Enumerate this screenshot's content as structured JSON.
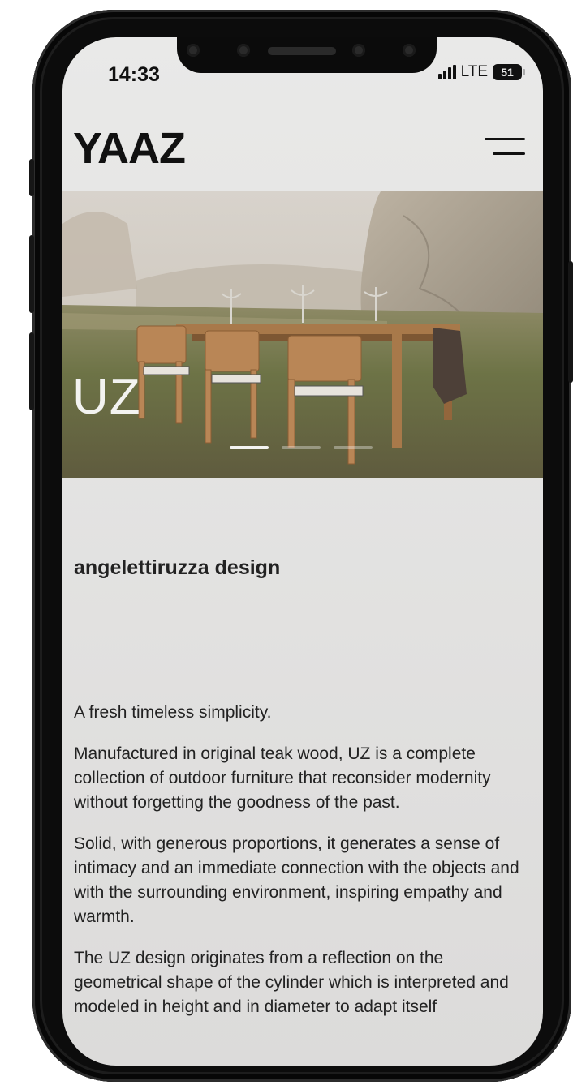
{
  "status_bar": {
    "time": "14:33",
    "network": "LTE",
    "battery": "51"
  },
  "header": {
    "logo": "YAAZ"
  },
  "hero": {
    "title": "UZ",
    "slides": [
      {
        "active": true
      },
      {
        "active": false
      },
      {
        "active": false
      }
    ]
  },
  "content": {
    "designer": "angelettiruzza design",
    "paragraphs": [
      "A fresh timeless simplicity.",
      "Manufactured in original teak wood, UZ is a complete collection of outdoor furniture that reconsider modernity without forgetting the goodness of the past.",
      "Solid, with generous proportions, it generates a sense of intimacy and an immediate connection with the objects and with the surrounding environment, inspiring empathy and warmth.",
      "The UZ design originates from a reflection on the geometrical shape of the cylinder which is interpreted and modeled in height and in diameter to adapt itself"
    ]
  },
  "colors": {
    "background": "#e3e2e1",
    "text": "#222222",
    "frame": "#0c0c0c"
  },
  "icons": {
    "menu": "hamburger-icon",
    "signal": "signal-bars-icon",
    "battery": "battery-icon"
  }
}
